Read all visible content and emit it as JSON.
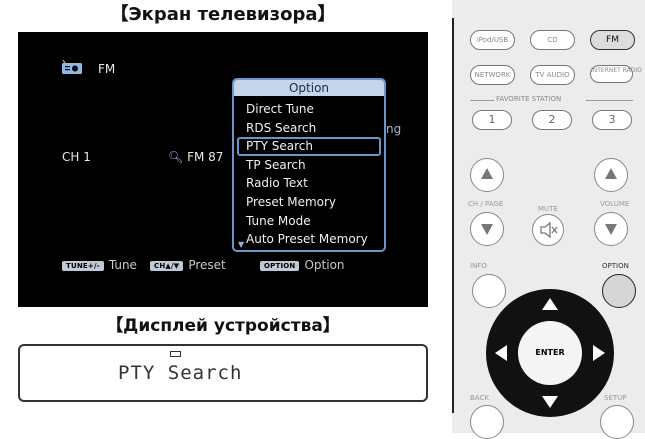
{
  "tv": {
    "title": "【Экран телевизора】",
    "source_label": "FM",
    "channel": "CH 1",
    "frequency": "FM 87",
    "overflow_text": "ng",
    "popup": {
      "title": "Option",
      "items": [
        "Direct Tune",
        "RDS Search",
        "PTY Search",
        "TP Search",
        "Radio Text",
        "Preset Memory",
        "Tune Mode",
        "Auto Preset Memory"
      ],
      "selected_index": 2
    },
    "footer": [
      {
        "key": "TUNE+/-",
        "label": "Tune"
      },
      {
        "key": "CH▲/▼",
        "label": "Preset"
      },
      {
        "key": "OPTION",
        "label": "Option"
      }
    ],
    "icon": "radio-icon",
    "icon_color": "#8fb8e6"
  },
  "device": {
    "title": "【Дисплей устройства】",
    "display_text": "PTY Search"
  },
  "remote": {
    "sources": [
      "iPod/USB",
      "CD",
      "FM",
      "NETWORK",
      "TV AUDIO",
      "INTERNET RADIO"
    ],
    "favorite_label": "FAVORITE STATION",
    "favorites": [
      "1",
      "2",
      "3"
    ],
    "ch_page_label": "CH / PAGE",
    "mute_label": "MUTE",
    "volume_label": "VOLUME",
    "info_label": "INFO",
    "option_label": "OPTION",
    "enter_label": "ENTER",
    "back_label": "BACK",
    "setup_label": "SETUP"
  }
}
